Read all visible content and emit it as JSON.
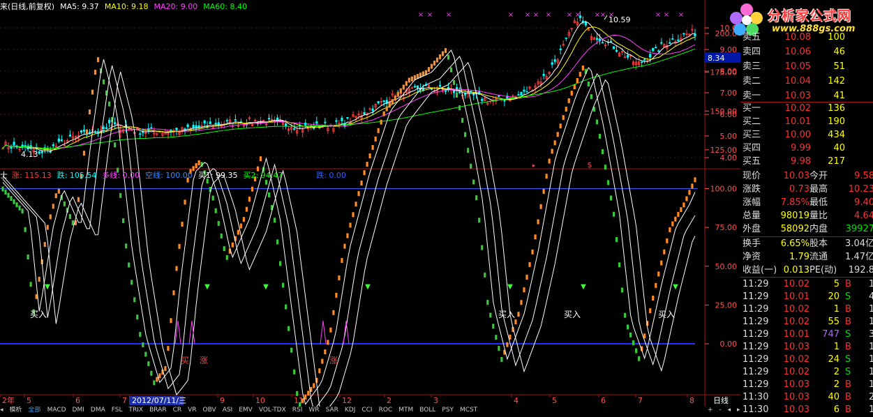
{
  "colors": {
    "bg": "#000000",
    "grid_red": "#8b0000",
    "price_axis": "#ff5252",
    "ma5": "#ffffff",
    "ma10": "#ffff00",
    "ma20": "#ff40ff",
    "ma60": "#00ff00",
    "up": "#ff4040",
    "down": "#00ffff",
    "orange": "#ff8c28",
    "green": "#3cc83c",
    "blue_line": "#3060ff",
    "quote_up": "#ff3030",
    "quote_green": "#00e000"
  },
  "main_legend": {
    "title": "来(日线,前复权)",
    "ma5": "MA5: 9.37",
    "ma10": "MA10: 9.18",
    "ma20": "MA20: 9.00",
    "ma60": "MA60: 8.40"
  },
  "sub_legend": {
    "title": "士",
    "zhang": "涨: 115.13",
    "die": "跌: 105.54",
    "duoxian": "多线: 0.00",
    "kongxian": "空线: 100.00",
    "mai1": "买1: 99.35",
    "mai2": "买2: 94.47",
    "dian": "跌: 0.00"
  },
  "price_axis": {
    "labels": [
      "10.0",
      "9.00",
      "8.00",
      "7.00",
      "6.00",
      "5.00",
      "4.00"
    ],
    "current_tag": "8.34"
  },
  "sub_axis": {
    "labels": [
      "200.0",
      "175.00",
      "150.00",
      "125.00",
      "100.00",
      "75.00",
      "50.00",
      "25.00",
      "0.00"
    ]
  },
  "annotations": {
    "high": "10.59",
    "low": "4.13",
    "buy": "买入",
    "signal_a": "买",
    "signal_b": "涨",
    "signal_c": "涨"
  },
  "date_axis": {
    "labels": [
      "2年",
      "5",
      "6",
      "7",
      "2012/07/11/三",
      "9",
      "10",
      "11",
      "12",
      "2",
      "3",
      "4",
      "5",
      "6",
      "7",
      "8"
    ],
    "period": "日线"
  },
  "tabs": [
    "模析",
    "全部",
    "MACD",
    "DMI",
    "DMA",
    "FSL",
    "TRIX",
    "BRAR",
    "CR",
    "VR",
    "OBV",
    "ASI",
    "EMV",
    "VOL-TDX",
    "RSI",
    "WR",
    "SAR",
    "KDJ",
    "CCI",
    "ROC",
    "MTM",
    "BOLL",
    "PSY",
    "MCST"
  ],
  "watermark": {
    "title": "分析家公式网",
    "url": "www.888gs.com"
  },
  "order_book": {
    "sell": [
      {
        "label": "卖五",
        "price": "10.08",
        "vol": "100"
      },
      {
        "label": "卖四",
        "price": "10.06",
        "vol": "46"
      },
      {
        "label": "卖三",
        "price": "10.05",
        "vol": "51"
      },
      {
        "label": "卖二",
        "price": "10.04",
        "vol": "142"
      },
      {
        "label": "卖一",
        "price": "10.03",
        "vol": "41"
      }
    ],
    "buy": [
      {
        "label": "买一",
        "price": "10.02",
        "vol": "136"
      },
      {
        "label": "买二",
        "price": "10.01",
        "vol": "190"
      },
      {
        "label": "买三",
        "price": "10.00",
        "vol": "434"
      },
      {
        "label": "买四",
        "price": "9.99",
        "vol": "40"
      },
      {
        "label": "买五",
        "price": "9.98",
        "vol": "217"
      }
    ]
  },
  "stats": [
    {
      "l1": "现价",
      "v1": "10.03",
      "l2": "今开",
      "v2": "9.58"
    },
    {
      "l1": "涨跌",
      "v1": "0.73",
      "l2": "最高",
      "v2": "10.23"
    },
    {
      "l1": "涨幅",
      "v1": "7.85%",
      "l2": "最低",
      "v2": "9.40"
    },
    {
      "l1": "总量",
      "v1": "98019",
      "l2": "量比",
      "v2": "4.64"
    },
    {
      "l1": "外盘",
      "v1": "58092",
      "l2": "内盘",
      "v2": "39927"
    }
  ],
  "stats2": [
    {
      "l1": "换手",
      "v1": "6.65%",
      "l2": "股本",
      "v2": "3.04亿"
    },
    {
      "l1": "净资",
      "v1": "1.79",
      "l2": "流通",
      "v2": "1.47亿"
    },
    {
      "l1": "收益(一)",
      "v1": "0.013",
      "l2": "PE(动)",
      "v2": "192.8"
    }
  ],
  "ticks": [
    {
      "t": "11:29",
      "p": "10.02",
      "v": "5",
      "s": "B",
      "n": "1"
    },
    {
      "t": "11:29",
      "p": "10.01",
      "v": "20",
      "s": "S",
      "n": "4"
    },
    {
      "t": "11:29",
      "p": "10.02",
      "v": "1",
      "s": "B",
      "n": "1"
    },
    {
      "t": "11:29",
      "p": "10.02",
      "v": "55",
      "s": "B",
      "n": "1"
    },
    {
      "t": "11:29",
      "p": "10.01",
      "v": "747",
      "s": "S",
      "n": "3"
    },
    {
      "t": "11:29",
      "p": "10.03",
      "v": "1",
      "s": "B",
      "n": "1"
    },
    {
      "t": "11:29",
      "p": "10.02",
      "v": "24",
      "s": "S",
      "n": "1"
    },
    {
      "t": "11:29",
      "p": "10.02",
      "v": "2",
      "s": "S",
      "n": "1"
    },
    {
      "t": "11:29",
      "p": "10.03",
      "v": "2",
      "s": "B",
      "n": "1"
    },
    {
      "t": "11:30",
      "p": "10.03",
      "v": "40",
      "s": "B",
      "n": "2"
    },
    {
      "t": "11:30",
      "p": "10.03",
      "v": "6",
      "s": "B",
      "n": "1"
    }
  ]
}
